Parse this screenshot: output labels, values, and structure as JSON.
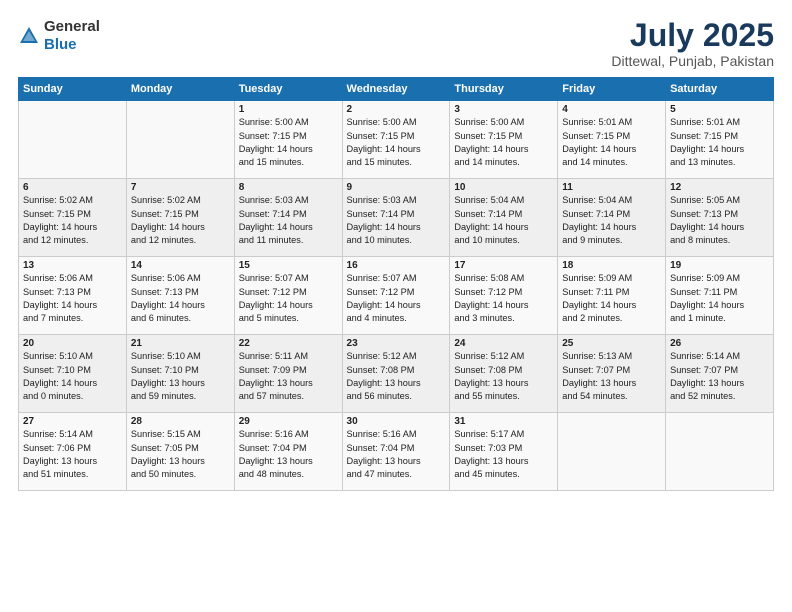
{
  "header": {
    "logo_general": "General",
    "logo_blue": "Blue",
    "month": "July 2025",
    "location": "Dittewal, Punjab, Pakistan"
  },
  "columns": [
    "Sunday",
    "Monday",
    "Tuesday",
    "Wednesday",
    "Thursday",
    "Friday",
    "Saturday"
  ],
  "rows": [
    [
      {
        "day": "",
        "text": ""
      },
      {
        "day": "",
        "text": ""
      },
      {
        "day": "1",
        "text": "Sunrise: 5:00 AM\nSunset: 7:15 PM\nDaylight: 14 hours\nand 15 minutes."
      },
      {
        "day": "2",
        "text": "Sunrise: 5:00 AM\nSunset: 7:15 PM\nDaylight: 14 hours\nand 15 minutes."
      },
      {
        "day": "3",
        "text": "Sunrise: 5:00 AM\nSunset: 7:15 PM\nDaylight: 14 hours\nand 14 minutes."
      },
      {
        "day": "4",
        "text": "Sunrise: 5:01 AM\nSunset: 7:15 PM\nDaylight: 14 hours\nand 14 minutes."
      },
      {
        "day": "5",
        "text": "Sunrise: 5:01 AM\nSunset: 7:15 PM\nDaylight: 14 hours\nand 13 minutes."
      }
    ],
    [
      {
        "day": "6",
        "text": "Sunrise: 5:02 AM\nSunset: 7:15 PM\nDaylight: 14 hours\nand 12 minutes."
      },
      {
        "day": "7",
        "text": "Sunrise: 5:02 AM\nSunset: 7:15 PM\nDaylight: 14 hours\nand 12 minutes."
      },
      {
        "day": "8",
        "text": "Sunrise: 5:03 AM\nSunset: 7:14 PM\nDaylight: 14 hours\nand 11 minutes."
      },
      {
        "day": "9",
        "text": "Sunrise: 5:03 AM\nSunset: 7:14 PM\nDaylight: 14 hours\nand 10 minutes."
      },
      {
        "day": "10",
        "text": "Sunrise: 5:04 AM\nSunset: 7:14 PM\nDaylight: 14 hours\nand 10 minutes."
      },
      {
        "day": "11",
        "text": "Sunrise: 5:04 AM\nSunset: 7:14 PM\nDaylight: 14 hours\nand 9 minutes."
      },
      {
        "day": "12",
        "text": "Sunrise: 5:05 AM\nSunset: 7:13 PM\nDaylight: 14 hours\nand 8 minutes."
      }
    ],
    [
      {
        "day": "13",
        "text": "Sunrise: 5:06 AM\nSunset: 7:13 PM\nDaylight: 14 hours\nand 7 minutes."
      },
      {
        "day": "14",
        "text": "Sunrise: 5:06 AM\nSunset: 7:13 PM\nDaylight: 14 hours\nand 6 minutes."
      },
      {
        "day": "15",
        "text": "Sunrise: 5:07 AM\nSunset: 7:12 PM\nDaylight: 14 hours\nand 5 minutes."
      },
      {
        "day": "16",
        "text": "Sunrise: 5:07 AM\nSunset: 7:12 PM\nDaylight: 14 hours\nand 4 minutes."
      },
      {
        "day": "17",
        "text": "Sunrise: 5:08 AM\nSunset: 7:12 PM\nDaylight: 14 hours\nand 3 minutes."
      },
      {
        "day": "18",
        "text": "Sunrise: 5:09 AM\nSunset: 7:11 PM\nDaylight: 14 hours\nand 2 minutes."
      },
      {
        "day": "19",
        "text": "Sunrise: 5:09 AM\nSunset: 7:11 PM\nDaylight: 14 hours\nand 1 minute."
      }
    ],
    [
      {
        "day": "20",
        "text": "Sunrise: 5:10 AM\nSunset: 7:10 PM\nDaylight: 14 hours\nand 0 minutes."
      },
      {
        "day": "21",
        "text": "Sunrise: 5:10 AM\nSunset: 7:10 PM\nDaylight: 13 hours\nand 59 minutes."
      },
      {
        "day": "22",
        "text": "Sunrise: 5:11 AM\nSunset: 7:09 PM\nDaylight: 13 hours\nand 57 minutes."
      },
      {
        "day": "23",
        "text": "Sunrise: 5:12 AM\nSunset: 7:08 PM\nDaylight: 13 hours\nand 56 minutes."
      },
      {
        "day": "24",
        "text": "Sunrise: 5:12 AM\nSunset: 7:08 PM\nDaylight: 13 hours\nand 55 minutes."
      },
      {
        "day": "25",
        "text": "Sunrise: 5:13 AM\nSunset: 7:07 PM\nDaylight: 13 hours\nand 54 minutes."
      },
      {
        "day": "26",
        "text": "Sunrise: 5:14 AM\nSunset: 7:07 PM\nDaylight: 13 hours\nand 52 minutes."
      }
    ],
    [
      {
        "day": "27",
        "text": "Sunrise: 5:14 AM\nSunset: 7:06 PM\nDaylight: 13 hours\nand 51 minutes."
      },
      {
        "day": "28",
        "text": "Sunrise: 5:15 AM\nSunset: 7:05 PM\nDaylight: 13 hours\nand 50 minutes."
      },
      {
        "day": "29",
        "text": "Sunrise: 5:16 AM\nSunset: 7:04 PM\nDaylight: 13 hours\nand 48 minutes."
      },
      {
        "day": "30",
        "text": "Sunrise: 5:16 AM\nSunset: 7:04 PM\nDaylight: 13 hours\nand 47 minutes."
      },
      {
        "day": "31",
        "text": "Sunrise: 5:17 AM\nSunset: 7:03 PM\nDaylight: 13 hours\nand 45 minutes."
      },
      {
        "day": "",
        "text": ""
      },
      {
        "day": "",
        "text": ""
      }
    ]
  ]
}
